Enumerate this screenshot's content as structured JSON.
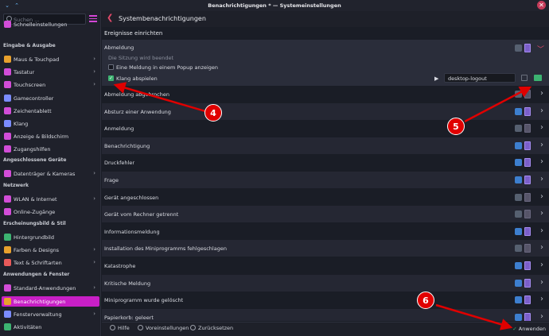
{
  "window": {
    "title": "Benachrichtigungen * — Systemeinstellungen",
    "close_glyph": "✕"
  },
  "sidebar": {
    "search_placeholder": "Suchen …",
    "items": [
      {
        "label": "Schnelleinstellungen",
        "icon": "quick-settings-icon",
        "color": "#d24dd8"
      },
      {
        "label": "Maus & Touchpad",
        "icon": "mouse-icon",
        "color": "#e8a12d",
        "chevron": true
      },
      {
        "label": "Tastatur",
        "icon": "keyboard-icon",
        "color": "#d24dd8",
        "chevron": true
      },
      {
        "label": "Touchscreen",
        "icon": "touchscreen-icon",
        "color": "#d24dd8",
        "chevron": true
      },
      {
        "label": "Gamecontroller",
        "icon": "gamepad-icon",
        "color": "#7b8cff"
      },
      {
        "label": "Zeichentablett",
        "icon": "tablet-icon",
        "color": "#d24dd8"
      },
      {
        "label": "Klang",
        "icon": "speaker-icon",
        "color": "#7b8cff"
      },
      {
        "label": "Anzeige & Bildschirm",
        "icon": "display-icon",
        "color": "#d24dd8"
      },
      {
        "label": "Zugangshilfen",
        "icon": "accessibility-icon",
        "color": "#d24dd8"
      },
      {
        "label": "Datenträger & Kameras",
        "icon": "drive-icon",
        "color": "#d24dd8",
        "chevron": true
      },
      {
        "label": "WLAN & Internet",
        "icon": "network-icon",
        "color": "#d24dd8",
        "chevron": true
      },
      {
        "label": "Online-Zugänge",
        "icon": "accounts-icon",
        "color": "#d24dd8"
      },
      {
        "label": "Hintergrundbild",
        "icon": "wallpaper-icon",
        "color": "#3cb371"
      },
      {
        "label": "Farben & Designs",
        "icon": "palette-icon",
        "color": "#e8a12d",
        "chevron": true
      },
      {
        "label": "Text & Schriftarten",
        "icon": "font-icon",
        "color": "#e85a5a",
        "chevron": true
      },
      {
        "label": "Standard-Anwendungen",
        "icon": "apps-icon",
        "color": "#d24dd8",
        "chevron": true
      },
      {
        "label": "Benachrichtigungen",
        "icon": "notification-icon",
        "color": "#e8a12d",
        "active": true
      },
      {
        "label": "Fensterverwaltung",
        "icon": "window-icon",
        "color": "#7b8cff",
        "chevron": true
      },
      {
        "label": "Aktivitäten",
        "icon": "activities-icon",
        "color": "#3cb371"
      }
    ],
    "headings": [
      "Eingabe & Ausgabe",
      "Angeschlossene Geräte",
      "Netzwerk",
      "Erscheinungsbild & Stil",
      "Anwendungen & Fenster"
    ]
  },
  "header": {
    "back_glyph": "❮",
    "title": "Systembenachrichtigungen"
  },
  "section_title": "Ereignisse einrichten",
  "expanded": {
    "title": "Abmeldung",
    "description": "Die Sitzung wird beendet",
    "popup_option": "Eine Meldung in einem Popup anzeigen",
    "popup_checked": false,
    "sound_option": "Klang abspielen",
    "sound_checked": true,
    "sound_file": "desktop-logout",
    "play_glyph": "▶",
    "check_glyph": "✓",
    "collapse_glyph": "﹀"
  },
  "events": [
    {
      "label": "Abmeldung abgebrochen",
      "active": false
    },
    {
      "label": "Absturz einer Anwendung",
      "active": true
    },
    {
      "label": "Anmeldung",
      "active": false
    },
    {
      "label": "Benachrichtigung",
      "active": true
    },
    {
      "label": "Druckfehler",
      "active": true
    },
    {
      "label": "Frage",
      "active": true
    },
    {
      "label": "Gerät angeschlossen",
      "active": false
    },
    {
      "label": "Gerät vom Rechner getrennt",
      "active": false
    },
    {
      "label": "Informationsmeldung",
      "active": true
    },
    {
      "label": "Installation des Miniprogramms fehlgeschlagen",
      "active": false
    },
    {
      "label": "Katastrophe",
      "active": true
    },
    {
      "label": "Kritische Meldung",
      "active": true
    },
    {
      "label": "Miniprogramm wurde gelöscht",
      "active": true
    },
    {
      "label": "Papierkorb: geleert",
      "active": true
    }
  ],
  "row_chevron": "›",
  "footer": {
    "help": "Hilfe",
    "defaults": "Voreinstellungen",
    "reset": "Zurücksetzen",
    "apply": "Anwenden",
    "apply_glyph": "✓"
  },
  "callouts": [
    "4",
    "5",
    "6"
  ],
  "colors": {
    "accent": "#c81fc6",
    "annotation": "#e00000",
    "apply_green": "#3cb371"
  }
}
